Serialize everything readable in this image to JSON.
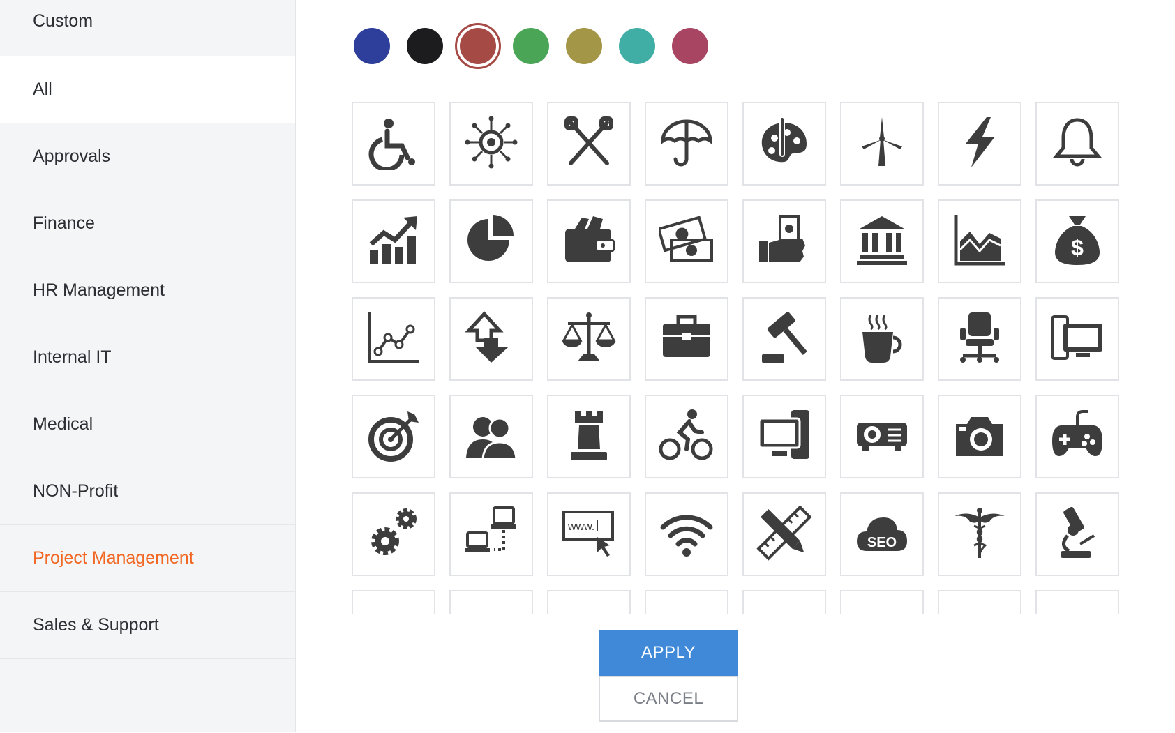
{
  "sidebar": {
    "items": [
      {
        "label": "Custom"
      },
      {
        "label": "All"
      },
      {
        "label": "Approvals"
      },
      {
        "label": "Finance"
      },
      {
        "label": "HR Management"
      },
      {
        "label": "Internal IT"
      },
      {
        "label": "Medical"
      },
      {
        "label": "NON-Profit"
      },
      {
        "label": "Project Management"
      },
      {
        "label": "Sales & Support"
      }
    ]
  },
  "colors": {
    "palette": [
      "#2d3f9a",
      "#1c1c1e",
      "#a64a45",
      "#4aa557",
      "#a39647",
      "#41aea5",
      "#a74562"
    ],
    "selected": "#a64a45",
    "icon": "#3d3d3d",
    "accent_text": "#f26722",
    "apply_bg": "#4089d9"
  },
  "icons": [
    "wheelchair-icon",
    "virus-icon",
    "crossed-tools-icon",
    "umbrella-icon",
    "art-palette-icon",
    "wind-turbine-icon",
    "lightning-bolt-icon",
    "bell-icon",
    "growth-chart-icon",
    "pie-chart-icon",
    "wallet-icon",
    "cash-bills-icon",
    "hand-holding-cash-icon",
    "bank-building-icon",
    "area-chart-icon",
    "money-bag-icon",
    "line-graph-icon",
    "transfer-arrows-icon",
    "scales-icon",
    "briefcase-icon",
    "gavel-icon",
    "coffee-cup-icon",
    "office-chair-icon",
    "desktop-computer-icon",
    "target-icon",
    "people-icon",
    "chess-rook-icon",
    "cyclist-icon",
    "computer-workstation-icon",
    "projector-icon",
    "camera-icon",
    "gamepad-icon",
    "gears-icon",
    "network-icon",
    "web-url-icon",
    "wifi-icon",
    "pencil-ruler-icon",
    "seo-cloud-icon",
    "caduceus-icon",
    "microscope-icon",
    "partial-icon-1",
    "partial-icon-2",
    "partial-icon-3",
    "partial-icon-4",
    "partial-icon-5",
    "partial-icon-6",
    "partial-icon-7",
    "partial-icon-8"
  ],
  "icon_texts": {
    "url": "www.",
    "seo": "SEO"
  },
  "footer": {
    "apply_label": "APPLY",
    "cancel_label": "CANCEL"
  }
}
